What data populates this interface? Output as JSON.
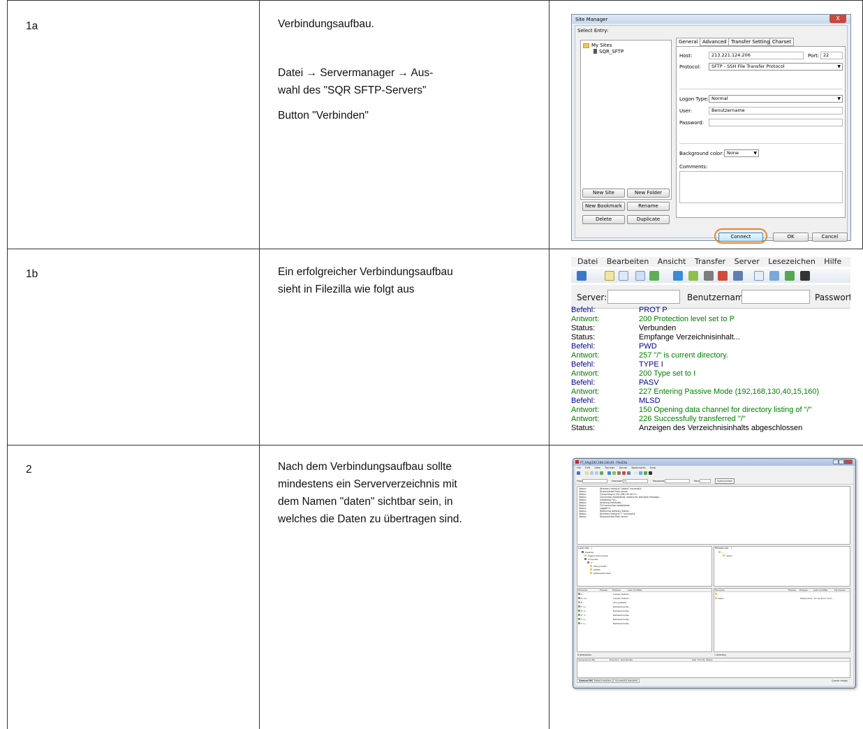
{
  "rows": [
    {
      "id": "1a",
      "text_lines": [
        "Verbindungsaufbau.",
        "",
        "Datei → Servermanager → Aus-",
        "wahl des \"SQR SFTP-Servers\"",
        "",
        "Button \"Verbinden\""
      ]
    },
    {
      "id": "1b",
      "text_lines": [
        "Ein erfolgreicher Verbindungsaufbau",
        "sieht in Filezilla wie folgt aus"
      ]
    },
    {
      "id": "2",
      "text_lines": [
        "Nach dem Verbindungsaufbau sollte",
        "mindestens ein Serververzeichnis mit",
        "dem Namen \"daten\" sichtbar sein, in",
        "welches die Daten zu übertragen sind."
      ]
    }
  ],
  "site_manager": {
    "title": "Site Manager",
    "close_glyph": "X",
    "select_entry_label": "Select Entry:",
    "tree": {
      "root": "My Sites",
      "entry": "SQR_SFTP"
    },
    "tabs": [
      "General",
      "Advanced",
      "Transfer Settings",
      "Charset"
    ],
    "host_label": "Host:",
    "host_value": "213.221.124.206",
    "port_label": "Port:",
    "port_value": "22",
    "protocol_label": "Protocol:",
    "protocol_value": "SFTP - SSH File Transfer Protocol",
    "logon_type_label": "Logon Type:",
    "logon_type_value": "Normal",
    "user_label": "User:",
    "user_value": "Benutzername",
    "password_label": "Password:",
    "password_value": "",
    "background_color_label": "Background color:",
    "background_color_value": "None",
    "comments_label": "Comments:",
    "buttons": {
      "new_site": "New Site",
      "new_folder": "New Folder",
      "new_bookmark": "New Bookmark",
      "rename": "Rename",
      "delete": "Delete",
      "duplicate": "Duplicate",
      "connect": "Connect",
      "ok": "OK",
      "cancel": "Cancel"
    },
    "highlight_color": "#e8862c"
  },
  "filezilla_log": {
    "menu": [
      "Datei",
      "Bearbeiten",
      "Ansicht",
      "Transfer",
      "Server",
      "Lesezeichen",
      "Hilfe"
    ],
    "server_label": "Server:",
    "username_label": "Benutzername:",
    "password_label": "Passwort:",
    "entries": [
      {
        "kind": "Befehl:",
        "msg": "PROT P",
        "type": "cmd"
      },
      {
        "kind": "Antwort:",
        "msg": "200 Protection level set to P",
        "type": "resp"
      },
      {
        "kind": "Status:",
        "msg": "Verbunden",
        "type": "status"
      },
      {
        "kind": "Status:",
        "msg": "Empfange Verzeichnisinhalt...",
        "type": "status"
      },
      {
        "kind": "Befehl:",
        "msg": "PWD",
        "type": "cmd"
      },
      {
        "kind": "Antwort:",
        "msg": "257 \"/\" is current directory.",
        "type": "resp"
      },
      {
        "kind": "Befehl:",
        "msg": "TYPE I",
        "type": "cmd"
      },
      {
        "kind": "Antwort:",
        "msg": "200 Type set to I",
        "type": "resp"
      },
      {
        "kind": "Befehl:",
        "msg": "PASV",
        "type": "cmd"
      },
      {
        "kind": "Antwort:",
        "msg": "227 Entering Passive Mode (192,168,130,40,15,160)",
        "type": "resp"
      },
      {
        "kind": "Befehl:",
        "msg": "MLSD",
        "type": "cmd"
      },
      {
        "kind": "Antwort:",
        "msg": "150 Opening data channel for directory listing of \"/\"",
        "type": "resp"
      },
      {
        "kind": "Antwort:",
        "msg": "226 Successfully transferred \"/\"",
        "type": "resp"
      },
      {
        "kind": "Status:",
        "msg": "Anzeigen des Verzeichnisinhalts abgeschlossen",
        "type": "status"
      }
    ],
    "colors": {
      "status": "#000000",
      "cmd": "#0000a0",
      "resp": "#008000"
    }
  },
  "filezilla_window": {
    "title": "FT_AA@192.168.130.40 - FileZilla",
    "menu": [
      "File",
      "Edit",
      "View",
      "Transfer",
      "Server",
      "Bookmarks",
      "Help"
    ],
    "host_label": "Host:",
    "username_label": "Username:",
    "username_value": "FT_",
    "password_label": "Password:",
    "port_label": "Port:",
    "quickconnect": "Quickconnect",
    "log": [
      {
        "kind": "Status:",
        "msg": "Directory listing of \"/daten\" successful"
      },
      {
        "kind": "Status:",
        "msg": "Disconnected from server"
      },
      {
        "kind": "Status:",
        "msg": "Connecting to 192.168.130.40:21..."
      },
      {
        "kind": "Status:",
        "msg": "Connection established, waiting for welcome message..."
      },
      {
        "kind": "Status:",
        "msg": "Initializing TLS..."
      },
      {
        "kind": "Status:",
        "msg": "Verifying certificate..."
      },
      {
        "kind": "Status:",
        "msg": "TLS connection established."
      },
      {
        "kind": "Status:",
        "msg": "Logged in"
      },
      {
        "kind": "Status:",
        "msg": "Retrieving directory listing..."
      },
      {
        "kind": "Status:",
        "msg": "Directory listing of \"/\" successful"
      },
      {
        "kind": "Status:",
        "msg": "Disconnected from server"
      }
    ],
    "local_site_label": "Local site:",
    "local_site_value": "\\",
    "remote_site_label": "Remote site:",
    "remote_site_value": "/",
    "local_tree": [
      "Desktop",
      "Eigene Dokumente",
      "Computer",
      "C:",
      "$Recycle.Bin",
      "$WHD",
      "DatabaseScripts"
    ],
    "remote_tree": [
      "/",
      "daten"
    ],
    "local_columns": [
      "Filename",
      "Filesize",
      "Filetype",
      "Last modified"
    ],
    "local_files": [
      {
        "name": "C:",
        "type": "Lokaler Datent..."
      },
      {
        "name": "D: (V...",
        "type": "Lokaler Datent..."
      },
      {
        "name": "E:",
        "type": "CD-Laufwerk"
      },
      {
        "name": "F: (\\...",
        "type": "Netzwerklaufw..."
      },
      {
        "name": "H: (\\...",
        "type": "Netzwerklaufw..."
      },
      {
        "name": "P: (\\...",
        "type": "Netzwerklaufw..."
      },
      {
        "name": "T: (\\...",
        "type": "Netzwerklaufw..."
      },
      {
        "name": "Y: (\\...",
        "type": "Netzwerklaufw..."
      }
    ],
    "remote_columns": [
      "Filename",
      "Filesize",
      "Filetype",
      "Last modified",
      "Permission"
    ],
    "remote_files": [
      {
        "name": "..",
        "type": "",
        "modified": ""
      },
      {
        "name": "daten",
        "type": "Dateiordner",
        "modified": "07.01.2017 13:0..."
      }
    ],
    "local_count": "8 directories",
    "remote_count": "1 directory",
    "queue_columns": [
      "Server/Local file",
      "Direction",
      "Remote file",
      "Size",
      "Priority",
      "Status"
    ],
    "queue_tabs": [
      "Queued files",
      "Failed transfers (2)",
      "Successful transfers"
    ],
    "queue_status": "Queue: empty"
  }
}
